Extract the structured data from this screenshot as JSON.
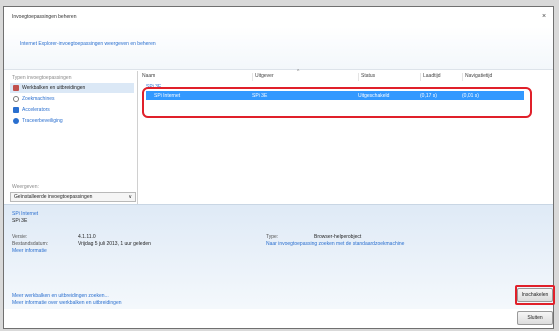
{
  "window": {
    "title": "Invoegtoepassingen beheren",
    "close_glyph": "×"
  },
  "header": {
    "link": "Internet Explorer-invoegtoepassingen weergeven en beheren"
  },
  "left_pane": {
    "section_label": "Typen invoegtoepassingen",
    "items": [
      {
        "label": "Werkbalken en uitbreidingen",
        "icon": "toolbar-gear-icon",
        "color": "#c0504d",
        "selected": true
      },
      {
        "label": "Zoekmachines",
        "icon": "search-icon",
        "color": "#7a7a7a",
        "selected": false
      },
      {
        "label": "Accelerators",
        "icon": "accelerator-icon",
        "color": "#2a6fcf",
        "selected": false
      },
      {
        "label": "Traceerbeveiliging",
        "icon": "tracking-protection-icon",
        "color": "#2a6fcf",
        "selected": false
      }
    ],
    "filter_label": "Weergeven:",
    "filter_value": "Geïnstalleerde invoegtoepassingen",
    "filter_chevron": "∨"
  },
  "list": {
    "columns": [
      "Naam",
      "Uitgever",
      "Status",
      "Laadtijd",
      "Navigatietijd"
    ],
    "sort_mark": "^",
    "group": "SPi 3E",
    "rows": [
      {
        "name": "SPi Internet",
        "publisher": "SPi 3E",
        "status": "Uitgeschakeld",
        "load_time": "(0,17 s)",
        "nav_time": "(0,01 s)"
      }
    ]
  },
  "details": {
    "name": "SPi Internet",
    "publisher": "SPi 3E",
    "version_label": "Versie:",
    "version_value": "4.1.11.0",
    "date_label": "Bestandsdatum:",
    "date_value": "Vrijdag 5 juli 2013, 1 uur geleden",
    "more_info": "Meer informatie",
    "type_label": "Type:",
    "type_value": "Browser-helperobject",
    "search_link": "Naar invoegtoepassing zoeken met de standaardzoekmachine",
    "bottom_links": [
      "Meer werkbalken en uitbreidingen zoeken...",
      "Meer informatie over werkbalken en uitbreidingen"
    ]
  },
  "buttons": {
    "enable": "Inschakelen",
    "close": "Sluiten"
  },
  "colors": {
    "selection": "#3399ff",
    "link": "#2a6fcf",
    "highlight": "#e0202a"
  }
}
